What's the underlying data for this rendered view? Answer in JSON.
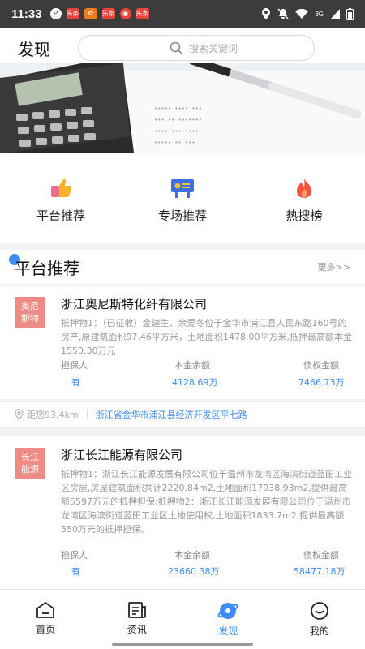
{
  "status": {
    "time": "11:33",
    "notif_labels": [
      "头条",
      "头条",
      "头条"
    ],
    "network": "3G"
  },
  "header": {
    "title": "发现",
    "search_placeholder": "搜索关键词"
  },
  "quick_links": [
    {
      "label": "平台推荐",
      "icon": "thumbs-up-icon"
    },
    {
      "label": "专场推荐",
      "icon": "billboard-icon"
    },
    {
      "label": "热搜榜",
      "icon": "flame-icon"
    }
  ],
  "section": {
    "title": "平台推荐",
    "more": "更多>>"
  },
  "stat_labels": {
    "guarantor": "担保人",
    "principal": "本金余额",
    "claim": "债权金额"
  },
  "cards": [
    {
      "badge": "奥尼斯特",
      "badge_line1": "奥尼",
      "badge_line2": "斯特",
      "name": "浙江奥尼斯特化纤有限公司",
      "desc": "抵押物1：（已征收）金建生、余爱冬位于金华市浦江县人民东路160号的房产,原建筑面积97.46平方米，土地面积1478.00平方米,抵押最高额本金1550.30万元",
      "guarantor": "有",
      "principal": "4128.69万",
      "claim": "7466.73万",
      "distance": "距您93.4km",
      "address": "浙江省金华市浦江县经济开发区平七路"
    },
    {
      "badge": "长江能源",
      "badge_line1": "长江",
      "badge_line2": "能源",
      "name": "浙江长江能源有限公司",
      "desc": "抵押物1：浙江长江能源发展有限公司位于温州市龙湾区海滨街道蓝田工业区房屋,房屋建筑面积共计2220.84m2,土地面积17938.93m2,提供最高额5597万元的抵押担保;抵押物2：浙江长江能源发展有限公司位于温州市龙湾区海滨街道蓝田工业区土地使用权,土地面积1833.7m2,提供最高额550万元的抵押担保。",
      "guarantor": "有",
      "principal": "23660.38万",
      "claim": "58477.18万"
    }
  ],
  "tabs": [
    {
      "label": "首页",
      "icon": "home-icon"
    },
    {
      "label": "资讯",
      "icon": "news-icon"
    },
    {
      "label": "发现",
      "icon": "discover-icon"
    },
    {
      "label": "我的",
      "icon": "profile-icon"
    }
  ],
  "colors": {
    "accent": "#3d8df5",
    "badge": "#ef8b85",
    "status_bar": "#3c3c3c"
  }
}
